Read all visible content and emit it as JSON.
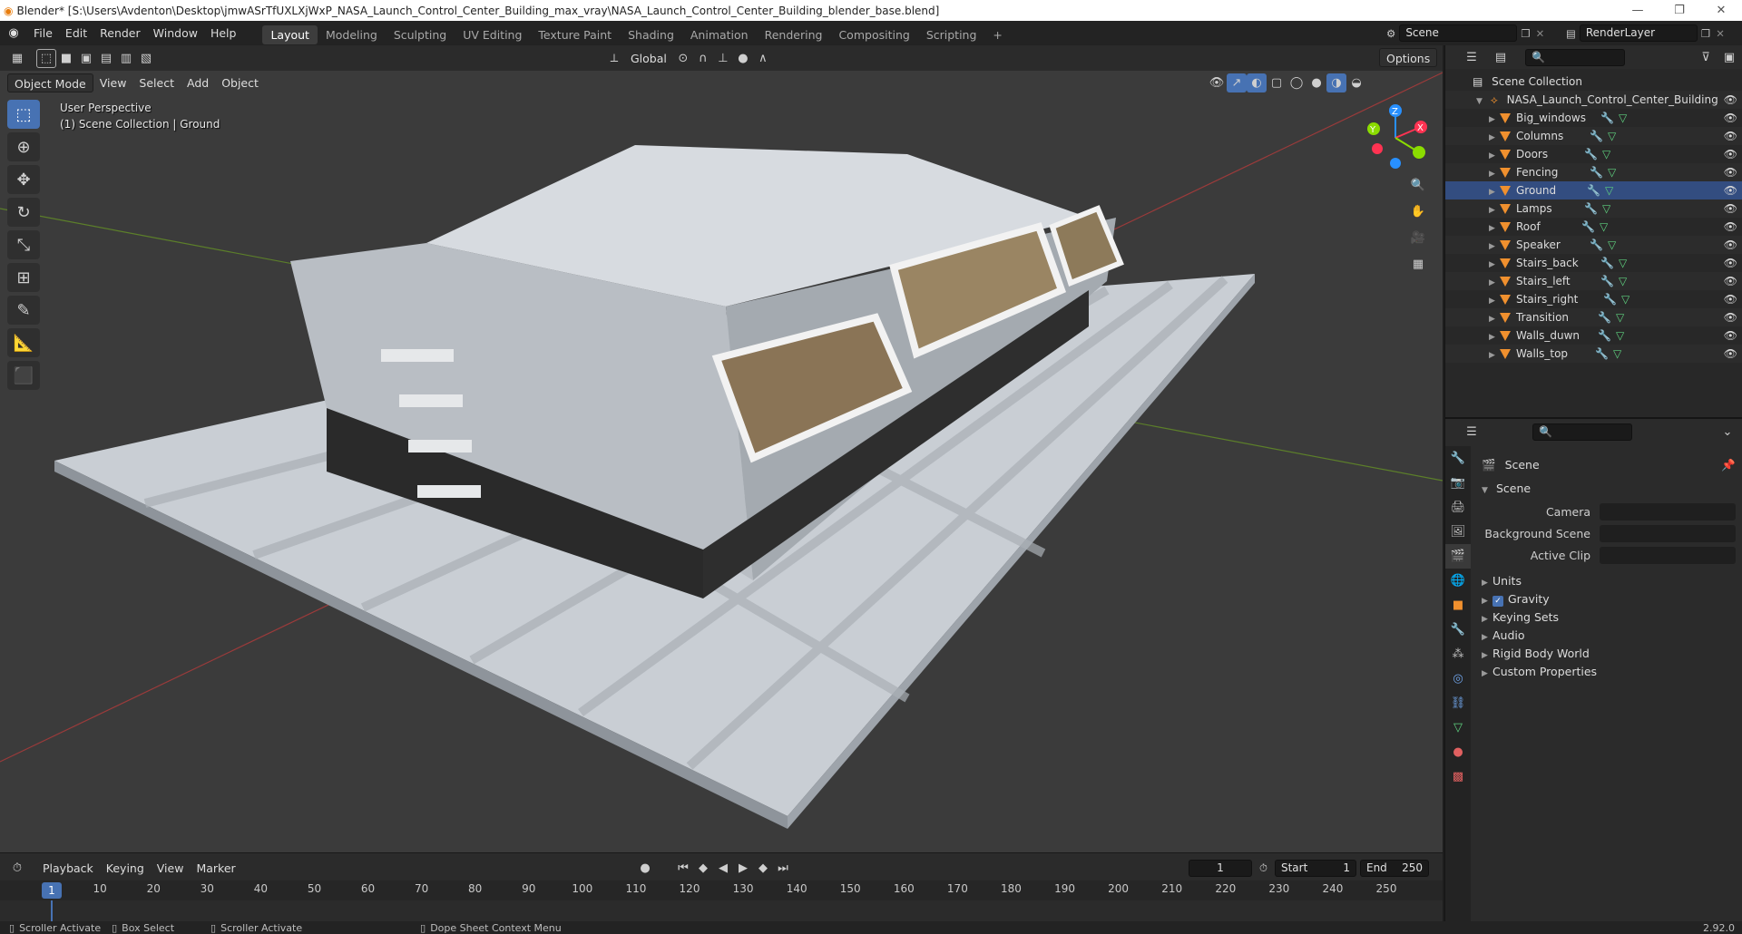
{
  "title_bar": {
    "text": "Blender* [S:\\Users\\Avdenton\\Desktop\\jmwASrTfUXLXjWxP_NASA_Launch_Control_Center_Building_max_vray\\NASA_Launch_Control_Center_Building_blender_base.blend]"
  },
  "menu": [
    "File",
    "Edit",
    "Render",
    "Window",
    "Help"
  ],
  "workspaces": [
    "Layout",
    "Modeling",
    "Sculpting",
    "UV Editing",
    "Texture Paint",
    "Shading",
    "Animation",
    "Rendering",
    "Compositing",
    "Scripting"
  ],
  "active_workspace": "Layout",
  "scene_field": "Scene",
  "renderlayer_field": "RenderLayer",
  "viewport": {
    "mode": "Object Mode",
    "menus": [
      "View",
      "Select",
      "Add",
      "Object"
    ],
    "transform_orientation": "Global",
    "options_label": "Options",
    "info_line1": "User Perspective",
    "info_line2": "(1) Scene Collection | Ground",
    "gizmo": {
      "x": "X",
      "y": "Y",
      "z": "Z"
    }
  },
  "outliner": {
    "root": "Scene Collection",
    "collection": "NASA_Launch_Control_Center_Building",
    "objects": [
      "Big_windows",
      "Columns",
      "Doors",
      "Fencing",
      "Ground",
      "Lamps",
      "Roof",
      "Speaker",
      "Stairs_back",
      "Stairs_left",
      "Stairs_right",
      "Transition",
      "Walls_duwn",
      "Walls_top"
    ],
    "selected": "Ground"
  },
  "properties": {
    "context": "Scene",
    "panel": "Scene",
    "fields": [
      {
        "label": "Camera"
      },
      {
        "label": "Background Scene"
      },
      {
        "label": "Active Clip"
      }
    ],
    "sections": [
      "Units",
      "Gravity",
      "Keying Sets",
      "Audio",
      "Rigid Body World",
      "Custom Properties"
    ],
    "gravity_checked": true
  },
  "timeline": {
    "menus": [
      "Playback",
      "Keying",
      "View",
      "Marker"
    ],
    "current_frame": "1",
    "start_label": "Start",
    "start": "1",
    "end_label": "End",
    "end": "250",
    "ticks": [
      "1",
      "10",
      "20",
      "30",
      "40",
      "50",
      "60",
      "70",
      "80",
      "90",
      "100",
      "110",
      "120",
      "130",
      "140",
      "150",
      "160",
      "170",
      "180",
      "190",
      "200",
      "210",
      "220",
      "230",
      "240",
      "250"
    ]
  },
  "statusbar": {
    "items": [
      "Scroller Activate",
      "Box Select",
      "Scroller Activate",
      "Dope Sheet Context Menu"
    ],
    "version": "2.92.0"
  },
  "colors": {
    "accent": "#4772b3",
    "object": "#f0902e",
    "mesh": "#5fd17f",
    "modifier": "#6fa3e8",
    "x_axis": "#ff3352",
    "y_axis": "#8bdc00",
    "z_axis": "#2890ff"
  }
}
